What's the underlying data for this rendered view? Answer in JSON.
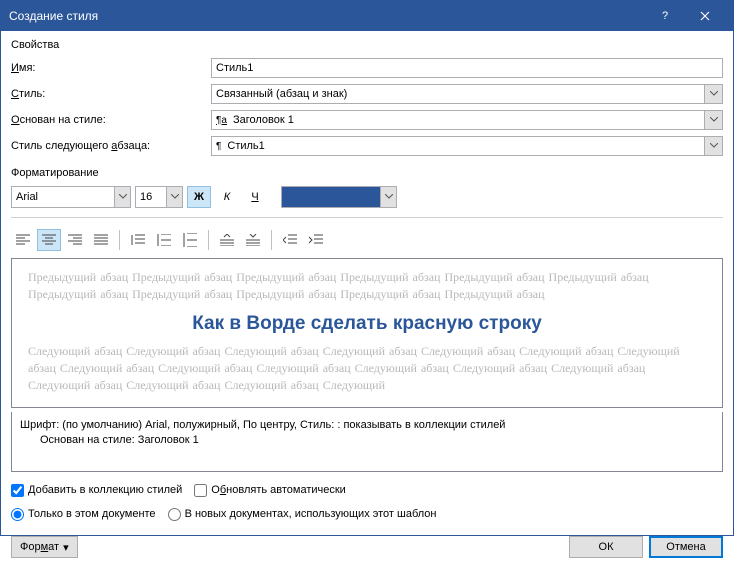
{
  "titlebar": {
    "title": "Создание стиля"
  },
  "groups": {
    "properties": "Свойства",
    "formatting": "Форматирование"
  },
  "labels": {
    "name_pre": "",
    "name_u": "И",
    "name_post": "мя:",
    "style_pre": "",
    "style_u": "С",
    "style_post": "тиль:",
    "based_pre": "",
    "based_u": "О",
    "based_post": "снован на стиле:",
    "next_pre": "Стиль следующего ",
    "next_u": "а",
    "next_post": "бзаца:",
    "add_pre": "",
    "add_u": "Д",
    "add_post": "обавить в коллекцию стилей",
    "auto_pre": "О",
    "auto_u": "б",
    "auto_post": "новлять автоматически",
    "doc_only": "Только в этом документе",
    "new_docs": "В новых документах, использующих этот шаблон",
    "format_pre": "Фор",
    "format_u": "м",
    "format_post": "ат"
  },
  "values": {
    "name": "Стиль1",
    "style_type": "Связанный (абзац и знак)",
    "based_on": "Заголовок 1",
    "next_style": "Стиль1",
    "font": "Arial",
    "size": "16"
  },
  "preview": {
    "ghost_prev": "Предыдущий абзац Предыдущий абзац Предыдущий абзац Предыдущий абзац Предыдущий абзац Предыдущий абзац Предыдущий абзац Предыдущий абзац Предыдущий абзац Предыдущий абзац Предыдущий абзац",
    "sample": "Как в Ворде сделать красную строку",
    "ghost_next": "Следующий абзац Следующий абзац Следующий абзац Следующий абзац Следующий абзац Следующий абзац Следующий абзац Следующий абзац Следующий абзац Следующий абзац Следующий абзац Следующий абзац Следующий абзац Следующий абзац Следующий абзац Следующий абзац Следующий"
  },
  "description": {
    "line1": "Шрифт: (по умолчанию) Arial, полужирный, По центру, Стиль: : показывать в коллекции стилей",
    "line2": "Основан на стиле: Заголовок 1"
  },
  "buttons": {
    "ok": "ОК",
    "cancel": "Отмена"
  },
  "toolbar": {
    "bold": "Ж",
    "italic": "К",
    "underline": "Ч"
  },
  "pilcrow_h": "¶a",
  "pilcrow": "¶"
}
